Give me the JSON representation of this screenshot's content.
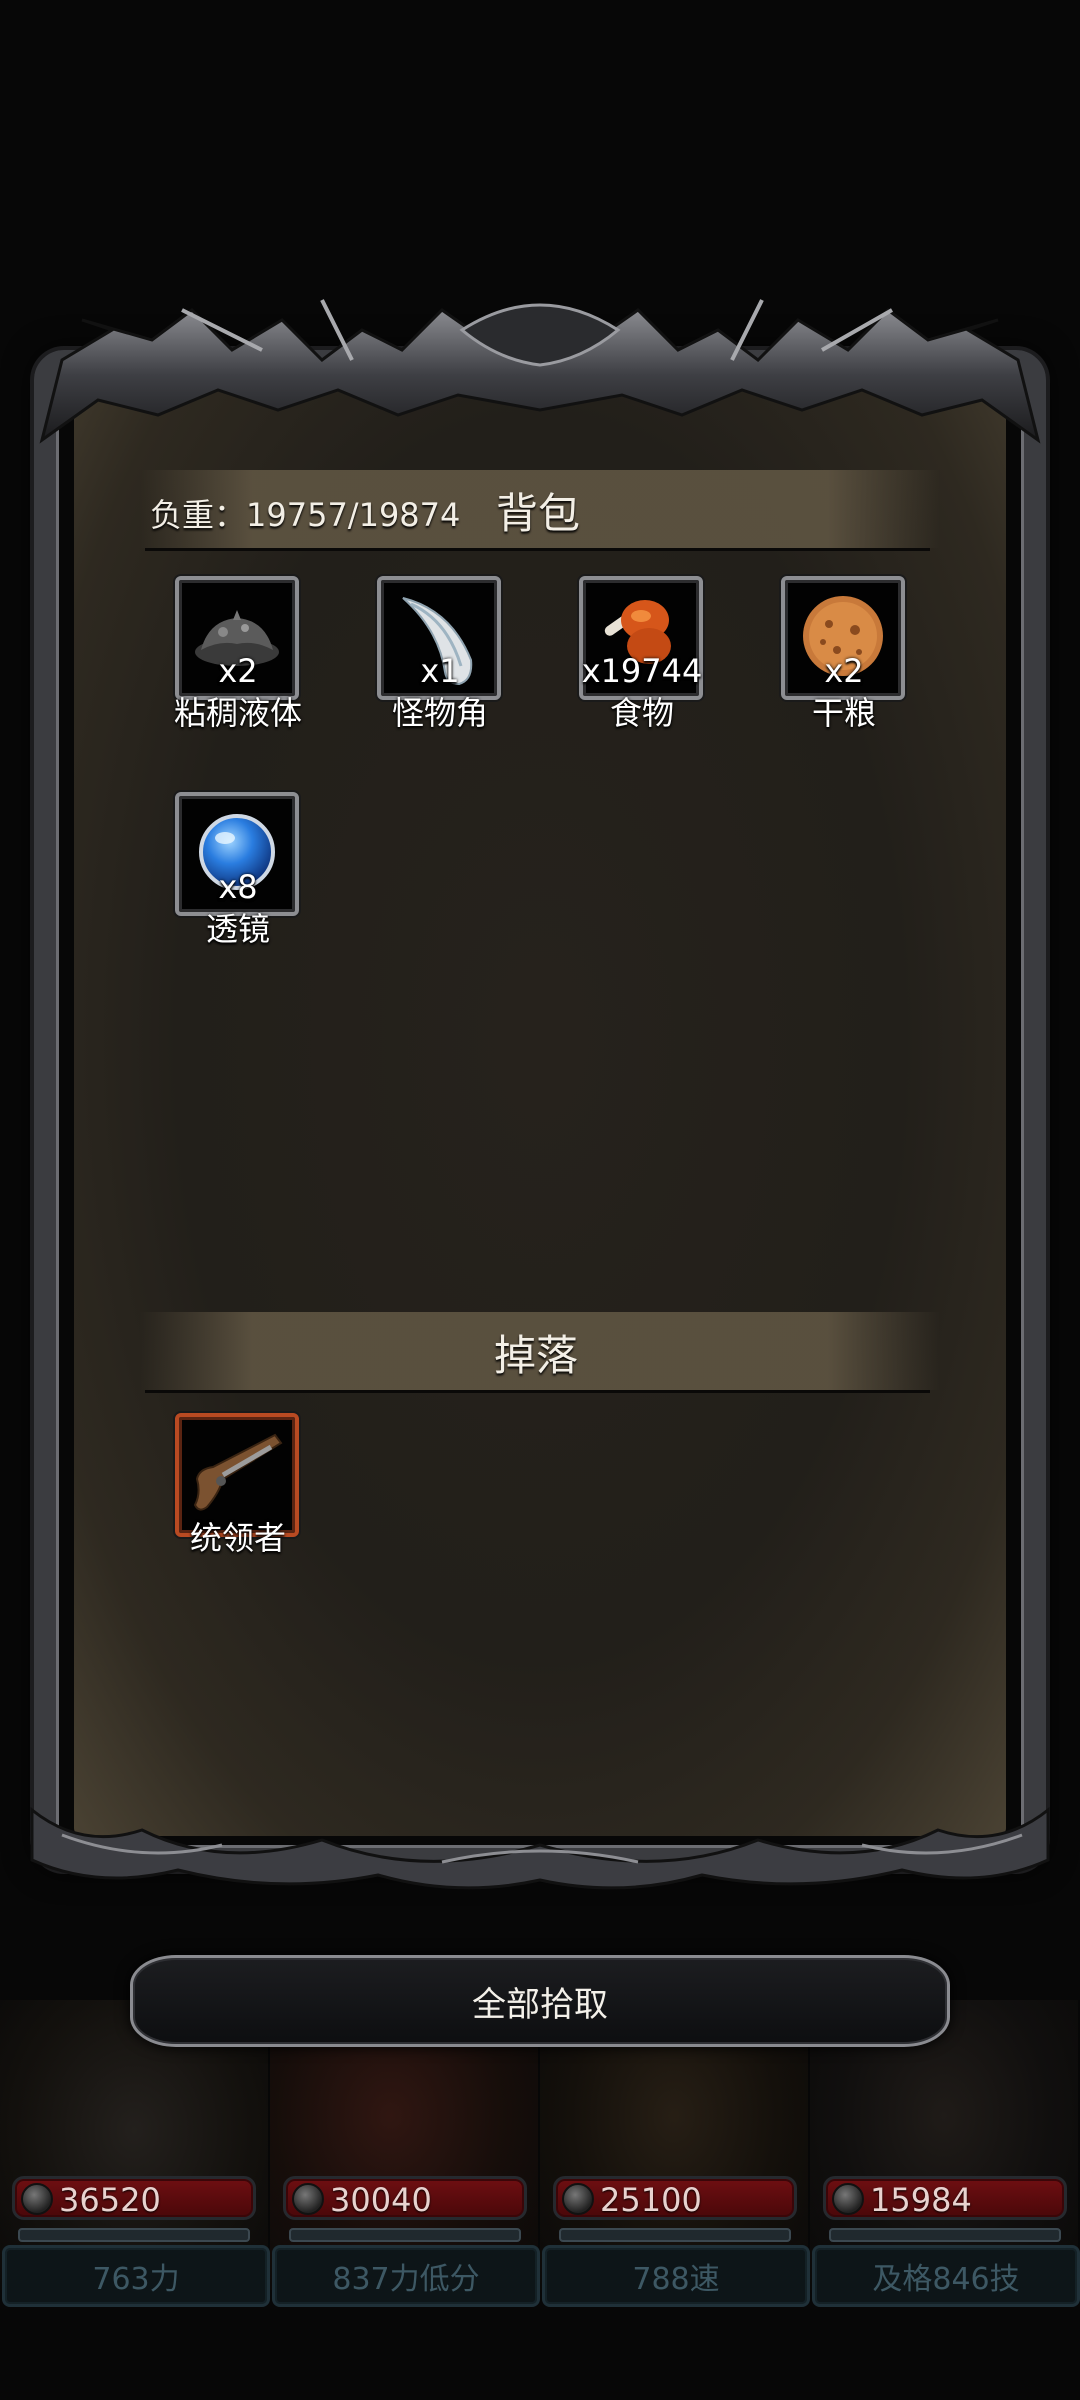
{
  "bag": {
    "weight_text": "负重：19757/19874",
    "title": "背包",
    "items": [
      {
        "count": "x2",
        "name": "粘稠液体",
        "icon": "slime-icon"
      },
      {
        "count": "x1",
        "name": "怪物角",
        "icon": "horn-icon"
      },
      {
        "count": "x19744",
        "name": "食物",
        "icon": "meat-icon"
      },
      {
        "count": "x2",
        "name": "干粮",
        "icon": "biscuit-icon"
      },
      {
        "count": "x8",
        "name": "透镜",
        "icon": "lens-icon"
      }
    ]
  },
  "drop": {
    "title": "掉落",
    "items": [
      {
        "name": "统领者",
        "icon": "pistol-icon"
      }
    ]
  },
  "pick_all_label": "全部拾取",
  "heroes": [
    {
      "hp": "36520",
      "stat": "763力"
    },
    {
      "hp": "30040",
      "stat": "837力低分"
    },
    {
      "hp": "25100",
      "stat": "788速"
    },
    {
      "hp": "15984",
      "stat": "及格846技"
    }
  ],
  "colors": {
    "panel": "#221f1a",
    "frame": "#3b3c40",
    "hp_bar": "#6e0f12",
    "drop_border": "#b94a22"
  }
}
